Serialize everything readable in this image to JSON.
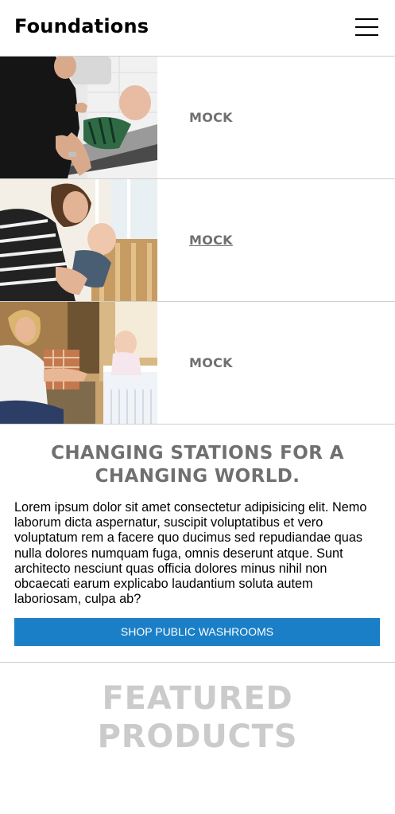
{
  "header": {
    "brand": "Foundations",
    "menu_icon": "hamburger-menu-icon"
  },
  "categories": [
    {
      "label": "MOCK",
      "image": "photo-father-changing-baby"
    },
    {
      "label": "MOCK",
      "image": "photo-mother-lifting-baby"
    },
    {
      "label": "MOCK",
      "image": "photo-mother-with-baby-in-playard"
    }
  ],
  "intro": {
    "heading": "CHANGING STATIONS FOR A CHANGING WORLD.",
    "body": "Lorem ipsum dolor sit amet consectetur adipisicing elit. Nemo laborum dicta aspernatur, suscipit voluptatibus et vero voluptatum rem a facere quo ducimus sed repudiandae quas nulla dolores numquam fuga, omnis deserunt atque. Sunt architecto nesciunt quas officia dolores minus nihil non obcaecati earum explicabo laudantium soluta autem laboriosam, culpa ab?",
    "button": "SHOP PUBLIC WASHROOMS"
  },
  "featured": {
    "heading_line1": "FEATURED",
    "heading_line2": "PRODUCTS"
  },
  "colors": {
    "accent": "#1a7fc6",
    "label_gray": "#707070",
    "featured_gray": "#cbcbcb",
    "divider": "#cfcfcf"
  }
}
